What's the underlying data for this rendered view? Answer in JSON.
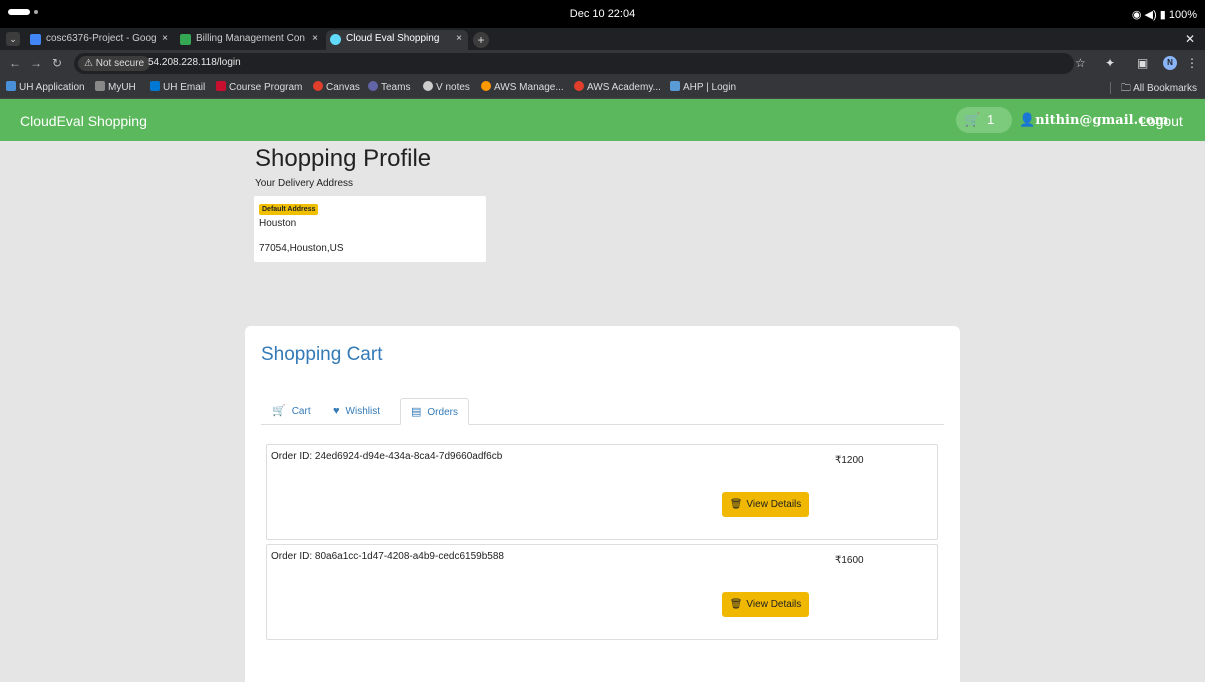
{
  "os": {
    "clock": "Dec 10  22:04",
    "status": "◉ ◀) ⚡100%",
    "battery": "100%"
  },
  "browser": {
    "tabs": [
      {
        "label": "cosc6376-Project - Goog",
        "fav_color": "#4285f4"
      },
      {
        "label": "Billing Management Con",
        "fav_color": "#34a853"
      },
      {
        "label": "Cloud Eval Shopping",
        "fav_color": "#61dafb"
      }
    ],
    "tab_close": "×",
    "new_tab": "+",
    "security": "⚠ Not secure",
    "url": "54.208.228.118/login",
    "avatar": "N",
    "bookmarks": [
      {
        "label": "UH Application",
        "color": "#4a90d9"
      },
      {
        "label": "MyUH",
        "color": "#888888"
      },
      {
        "label": "UH Email",
        "color": "#0078d4"
      },
      {
        "label": "Course Program",
        "color": "#c8102e"
      },
      {
        "label": "Canvas",
        "color": "#e13f2b"
      },
      {
        "label": "Teams",
        "color": "#6264a7"
      },
      {
        "label": "V notes",
        "color": "#cccccc"
      },
      {
        "label": "AWS Manage...",
        "color": "#ff9900"
      },
      {
        "label": "AWS Academy...",
        "color": "#e13f2b"
      },
      {
        "label": "AHP | Login",
        "color": "#5b9bd5"
      }
    ],
    "all_bookmarks": "All Bookmarks"
  },
  "navbar": {
    "brand": "CloudEval Shopping",
    "cart_count": "1",
    "user_email": "nithin@gmail.com",
    "logout": "Logout",
    "accent": "#5cb85c"
  },
  "profile": {
    "title": "Shopping Profile",
    "delivery_label": "Your Delivery Address",
    "badge": "Default Address",
    "city": "Houston",
    "address_line": "77054,Houston,US"
  },
  "cart": {
    "title": "Shopping Cart",
    "tabs": [
      {
        "label": "Cart",
        "icon": "cart-icon"
      },
      {
        "label": "Wishlist",
        "icon": "heart-icon"
      },
      {
        "label": "Orders",
        "icon": "list-icon"
      }
    ],
    "active_tab": "Orders",
    "orders": [
      {
        "id": "Order ID: 24ed6924-d94e-434a-8ca4-7d9660adf6cb",
        "price": "₹1200",
        "button": "View Details"
      },
      {
        "id": "Order ID: 80a6a1cc-1d47-4208-a4b9-cedc6159b588",
        "price": "₹1600",
        "button": "View Details"
      }
    ]
  }
}
